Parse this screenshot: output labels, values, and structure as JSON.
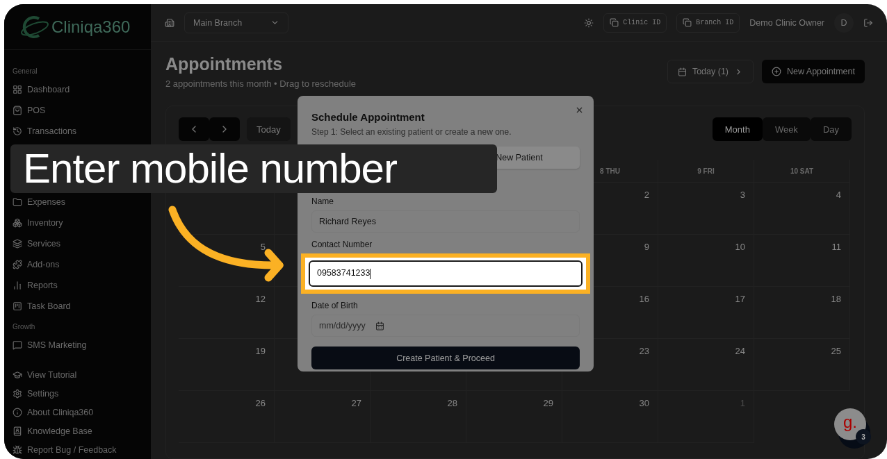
{
  "logo": {
    "text": "Cliniqa360"
  },
  "sidebar": {
    "sections": [
      {
        "label": "General",
        "items": [
          {
            "label": "Dashboard"
          },
          {
            "label": "POS"
          },
          {
            "label": "Transactions"
          },
          {
            "label": "Expenses"
          },
          {
            "label": "Inventory"
          },
          {
            "label": "Services"
          },
          {
            "label": "Add-ons"
          },
          {
            "label": "Reports"
          },
          {
            "label": "Task Board"
          }
        ]
      },
      {
        "label": "Growth",
        "items": [
          {
            "label": "SMS Marketing"
          }
        ]
      }
    ],
    "footer_items": [
      {
        "label": "View Tutorial"
      },
      {
        "label": "Settings"
      },
      {
        "label": "About Cliniqa360"
      },
      {
        "label": "Knowledge Base"
      },
      {
        "label": "Report Bug / Feedback"
      }
    ]
  },
  "topbar": {
    "branch": "Main Branch",
    "clinic_id": "Clinic ID",
    "branch_id": "Branch ID",
    "user": "Demo Clinic Owner",
    "avatar": "D"
  },
  "page": {
    "title": "Appointments",
    "subtitle": "2 appointments this month • Drag to reschedule",
    "today_button": "Today (1)",
    "new_button": "New Appointment"
  },
  "calendar": {
    "today": "Today",
    "views": [
      {
        "label": "Month",
        "selected": true
      },
      {
        "label": "Week",
        "selected": false
      },
      {
        "label": "Day",
        "selected": false
      }
    ],
    "headers": [
      "8 THU",
      "9 FRI",
      "10 SAT"
    ],
    "weeks": [
      [
        {
          "day": "2",
          "other_month": false
        },
        {
          "day": "3",
          "other_month": false
        },
        {
          "day": "4",
          "other_month": false
        }
      ],
      [
        {
          "day": "5",
          "other_month": false
        },
        {
          "day": "9",
          "other_month": false
        },
        {
          "day": "10",
          "other_month": false
        },
        {
          "day": "11",
          "other_month": false
        }
      ],
      [
        {
          "day": "12",
          "other_month": false
        },
        {
          "day": "16",
          "other_month": false
        },
        {
          "day": "17",
          "other_month": false
        },
        {
          "day": "18",
          "other_month": false
        }
      ],
      [
        {
          "day": "19",
          "other_month": false
        },
        {
          "day": "23",
          "other_month": false
        },
        {
          "day": "24",
          "other_month": false
        },
        {
          "day": "25",
          "other_month": false
        }
      ],
      [
        {
          "day": "26",
          "other_month": false
        },
        {
          "day": "27",
          "other_month": false
        },
        {
          "day": "28",
          "other_month": false
        },
        {
          "day": "29",
          "other_month": false
        },
        {
          "day": "30",
          "other_month": false
        },
        {
          "day": "1",
          "other_month": true
        }
      ]
    ]
  },
  "modal": {
    "title": "Schedule Appointment",
    "subtitle": "Step 1: Select an existing patient or create a new one.",
    "tabs": [
      {
        "label": "New Patient",
        "selected": true
      }
    ],
    "fields": [
      {
        "label": "Name",
        "value": "Richard Reyes",
        "highlighted": false,
        "kind": "text"
      },
      {
        "label": "Contact Number",
        "value": "09583741233",
        "highlighted": true,
        "kind": "text"
      },
      {
        "label": "Date of Birth",
        "placeholder": "mm/dd/yyyy",
        "highlighted": false,
        "kind": "date"
      }
    ],
    "submit": "Create Patient & Proceed"
  },
  "caption": {
    "text": "Enter mobile number"
  },
  "chat_widget": {
    "logo": "g.",
    "badge": "3"
  }
}
